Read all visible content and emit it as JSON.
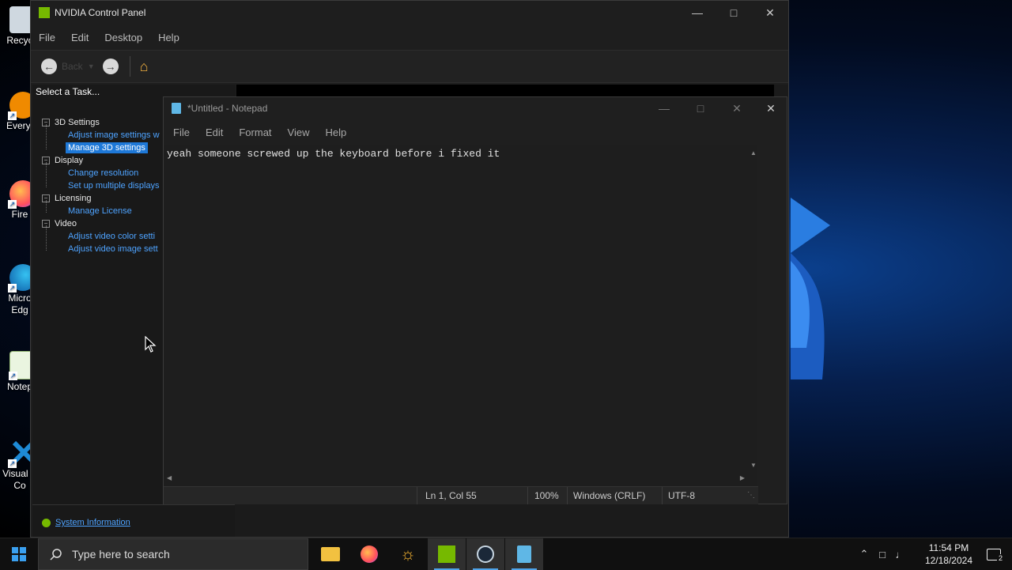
{
  "desktop": {
    "icons": [
      {
        "label": "Recyc",
        "icon": "recycle-bin-icon"
      },
      {
        "label": "Everyt",
        "icon": "everything-icon"
      },
      {
        "label": "Fire",
        "icon": "firefox-icon"
      },
      {
        "label": "Micro\nEdg",
        "icon": "edge-icon"
      },
      {
        "label": "Notep",
        "icon": "notepad-plus-icon"
      },
      {
        "label": "Visual S\nCo",
        "icon": "vscode-icon"
      }
    ]
  },
  "nvidia": {
    "title": "NVIDIA Control Panel",
    "menu": [
      "File",
      "Edit",
      "Desktop",
      "Help"
    ],
    "toolbar": {
      "back_label": "Back"
    },
    "task_header": "Select a Task...",
    "tree": {
      "settings3d": {
        "label": "3D Settings",
        "items": [
          "Adjust image settings w",
          "Manage 3D settings"
        ]
      },
      "display": {
        "label": "Display",
        "items": [
          "Change resolution",
          "Set up multiple displays"
        ]
      },
      "licensing": {
        "label": "Licensing",
        "items": [
          "Manage License"
        ]
      },
      "video": {
        "label": "Video",
        "items": [
          "Adjust video color setti",
          "Adjust video image sett"
        ]
      }
    },
    "selected_item": "Manage 3D settings",
    "system_information": "System Information"
  },
  "notepad": {
    "title": "*Untitled - Notepad",
    "menu": [
      "File",
      "Edit",
      "Format",
      "View",
      "Help"
    ],
    "content": "yeah someone screwed up the keyboard before i fixed it",
    "status": {
      "position": "Ln 1, Col 55",
      "zoom": "100%",
      "line_ending": "Windows (CRLF)",
      "encoding": "UTF-8"
    }
  },
  "taskbar": {
    "search_placeholder": "Type here to search",
    "apps": [
      "file-explorer-icon",
      "firefox-icon",
      "settings-sun-icon",
      "nvidia-icon",
      "steam-icon",
      "notepad-icon"
    ],
    "clock": {
      "time": "11:54 PM",
      "date": "12/18/2024"
    },
    "notification_count": "2"
  },
  "colors": {
    "accent": "#1e78d7",
    "link": "#4ea3ff",
    "nvidia_green": "#76b900"
  }
}
